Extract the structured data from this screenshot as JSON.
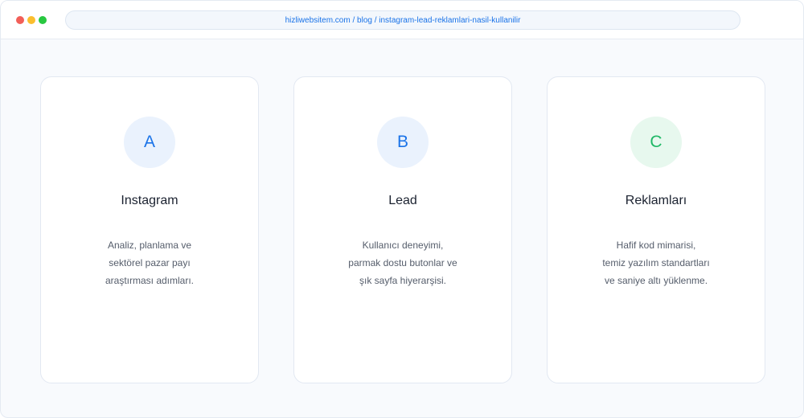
{
  "browser": {
    "url": "hizliwebsitem.com / blog / instagram-lead-reklamlari-nasil-kullanilir",
    "window_controls": {
      "close_color": "#f25f58",
      "minimize_color": "#fbbe2e",
      "maximize_color": "#28c840"
    }
  },
  "cards": [
    {
      "letter": "A",
      "title": "Instagram",
      "description_lines": [
        "Analiz, planlama ve",
        "sektörel pazar payı",
        "araştırması adımları."
      ],
      "badge_bg": "#eaf2fd",
      "badge_color": "#1a73e8"
    },
    {
      "letter": "B",
      "title": "Lead",
      "description_lines": [
        "Kullanıcı deneyimi,",
        "parmak dostu butonlar ve",
        "şık sayfa hiyerarşisi."
      ],
      "badge_bg": "#eaf2fd",
      "badge_color": "#1a73e8"
    },
    {
      "letter": "C",
      "title": "Reklamları",
      "description_lines": [
        "Hafif kod mimarisi,",
        "temiz yazılım standartları",
        "ve saniye altı yüklenme."
      ],
      "badge_bg": "#e7f8ee",
      "badge_color": "#1fb866"
    }
  ]
}
